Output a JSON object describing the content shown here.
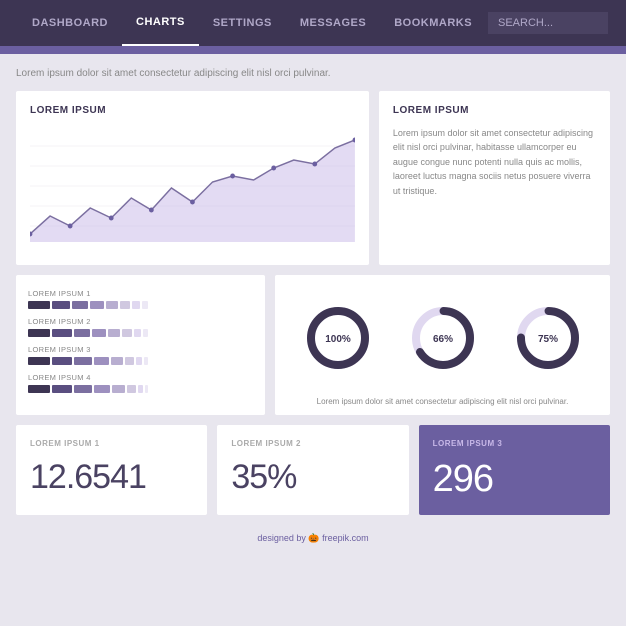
{
  "nav": {
    "items": [
      {
        "label": "DASHBOARD",
        "active": false
      },
      {
        "label": "CHARTS",
        "active": true
      },
      {
        "label": "SETTINGS",
        "active": false
      },
      {
        "label": "MESSAGES",
        "active": false
      },
      {
        "label": "BOOKMARKS",
        "active": false
      }
    ],
    "search_placeholder": "SEARCH..."
  },
  "subtitle": "Lorem ipsum dolor sit amet consectetur adipiscing elit nisl orci pulvinar.",
  "chart_card": {
    "title": "LOREM IPSUM",
    "area_data": [
      10,
      28,
      18,
      35,
      22,
      40,
      30,
      50,
      38,
      55,
      62,
      58,
      70,
      78,
      72,
      85
    ]
  },
  "text_card": {
    "title": "LOREM IPSUM",
    "body": "Lorem ipsum dolor sit amet consectetur adipiscing elit nisl orci pulvinar, habitasse ullamcorper eu augue congue nunc potenti nulla quis ac mollis, laoreet luctus magna sociis netus posuere viverra ut tristique."
  },
  "bar_card": {
    "rows": [
      {
        "label": "LOREM IPSUM 1",
        "segs": [
          5,
          4,
          3,
          2,
          2,
          1,
          1,
          1
        ]
      },
      {
        "label": "LOREM IPSUM 2",
        "segs": [
          5,
          4,
          4,
          3,
          2,
          2,
          1,
          1
        ]
      },
      {
        "label": "LOREM IPSUM 3",
        "segs": [
          5,
          5,
          4,
          3,
          3,
          2,
          1,
          1
        ]
      },
      {
        "label": "LOREM IPSUM 4",
        "segs": [
          5,
          5,
          5,
          4,
          3,
          2,
          1,
          1
        ]
      }
    ],
    "colors": [
      "#3d3553",
      "#5a4e80",
      "#7b6fa0",
      "#9d90bf",
      "#b8aed0",
      "#d0c8e0",
      "#e0d8f0",
      "#ece8f5"
    ]
  },
  "donut_card": {
    "donuts": [
      {
        "pct": 100,
        "label": "100%"
      },
      {
        "pct": 66,
        "label": "66%"
      },
      {
        "pct": 75,
        "label": "75%"
      }
    ],
    "subtitle": "Lorem ipsum dolor sit amet consectetur adipiscing elit nisl orci pulvinar."
  },
  "stats": [
    {
      "title": "LOREM IPSUM 1",
      "value": "12.6541",
      "purple": false
    },
    {
      "title": "LOREM IPSUM 2",
      "value": "35%",
      "purple": false
    },
    {
      "title": "LOREM IPSUM 3",
      "value": "296",
      "purple": true
    }
  ],
  "footer": {
    "text": "designed by",
    "brand": "🎃 freepik.com"
  }
}
